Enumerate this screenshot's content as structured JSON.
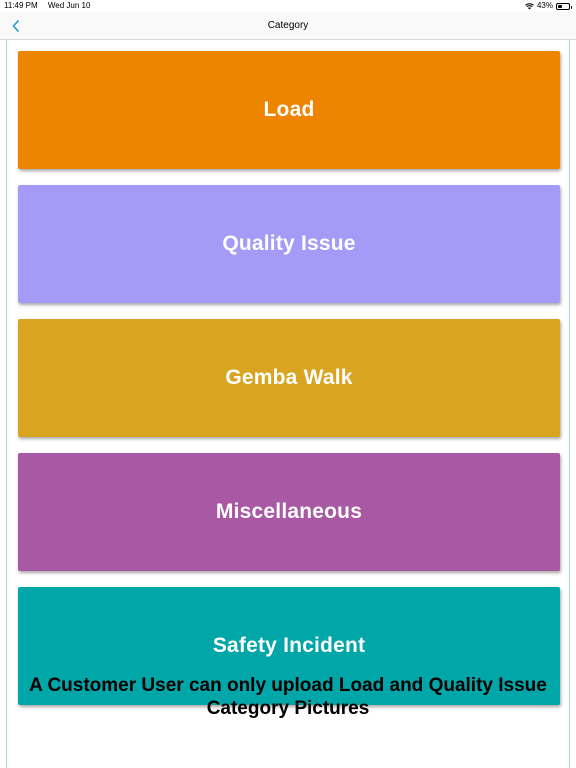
{
  "status_bar": {
    "time": "11:49 PM",
    "date": "Wed Jun 10",
    "battery_percent": "43%",
    "battery_level": 0.43,
    "icons": [
      "wifi-icon",
      "battery-icon"
    ]
  },
  "nav": {
    "title": "Category",
    "back_icon": "chevron-left-icon",
    "accent_color": "#1a9bd7"
  },
  "categories": [
    {
      "label": "Load",
      "color": "#ee8500"
    },
    {
      "label": "Quality Issue",
      "color": "#a39bf6"
    },
    {
      "label": "Gemba Walk",
      "color": "#d9a521"
    },
    {
      "label": "Miscellaneous",
      "color": "#a959a4"
    },
    {
      "label": "Safety Incident",
      "color": "#00a6a8"
    }
  ],
  "notice": "A Customer User can only upload Load and Quality Issue Category Pictures"
}
